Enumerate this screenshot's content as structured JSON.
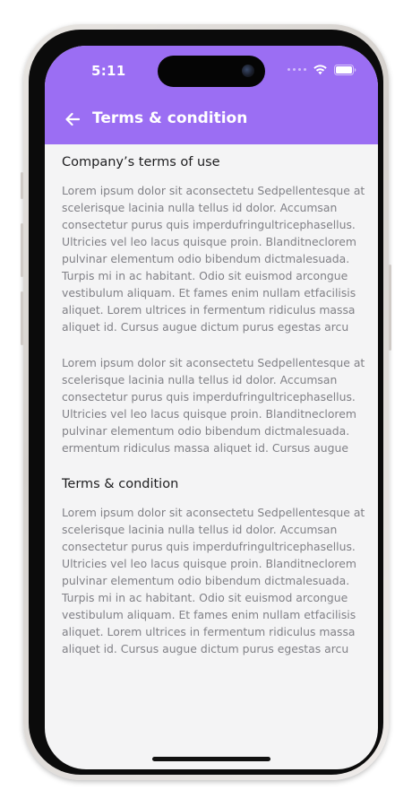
{
  "status_bar": {
    "time": "5:11"
  },
  "app_bar": {
    "title": "Terms & condition",
    "back_icon": "arrow-left-icon",
    "background_color": "#9b6ef3"
  },
  "sections": [
    {
      "heading": "Company’s terms of use",
      "paragraphs": [
        "Lorem ipsum dolor sit aconsectetu Sedpellentesque at scelerisque lacinia nulla tellus id dolor. Accumsan consectetur purus quis imperdufringultricephasellus. Ultricies vel leo lacus quisque proin. Blanditneclorem pulvinar elementum odio bibendum dictmalesuada. Turpis mi in ac habitant. Odio sit euismod  arcongue vestibulum aliquam. Et fames enim nullam etfacilisis aliquet. Lorem ultrices in fermentum ridiculus massa aliquet id. Cursus augue dictum purus egestas arcu",
        "Lorem ipsum dolor sit aconsectetu Sedpellentesque at scelerisque lacinia nulla tellus id dolor. Accumsan consectetur purus quis imperdufringultricephasellus. Ultricies vel leo lacus quisque proin. Blanditneclorem pulvinar elementum odio bibendum dictmalesuada. ermentum ridiculus massa aliquet id. Cursus augue"
      ]
    },
    {
      "heading": "Terms & condition",
      "paragraphs": [
        "Lorem ipsum dolor sit aconsectetu Sedpellentesque at scelerisque lacinia nulla tellus id dolor. Accumsan consectetur purus quis imperdufringultricephasellus. Ultricies vel leo lacus quisque proin. Blanditneclorem pulvinar elementum odio bibendum dictmalesuada. Turpis mi in ac habitant. Odio sit euismod  arcongue vestibulum aliquam. Et fames enim nullam etfacilisis aliquet. Lorem ultrices in fermentum ridiculus massa aliquet id. Cursus augue dictum purus egestas arcu"
      ]
    }
  ]
}
